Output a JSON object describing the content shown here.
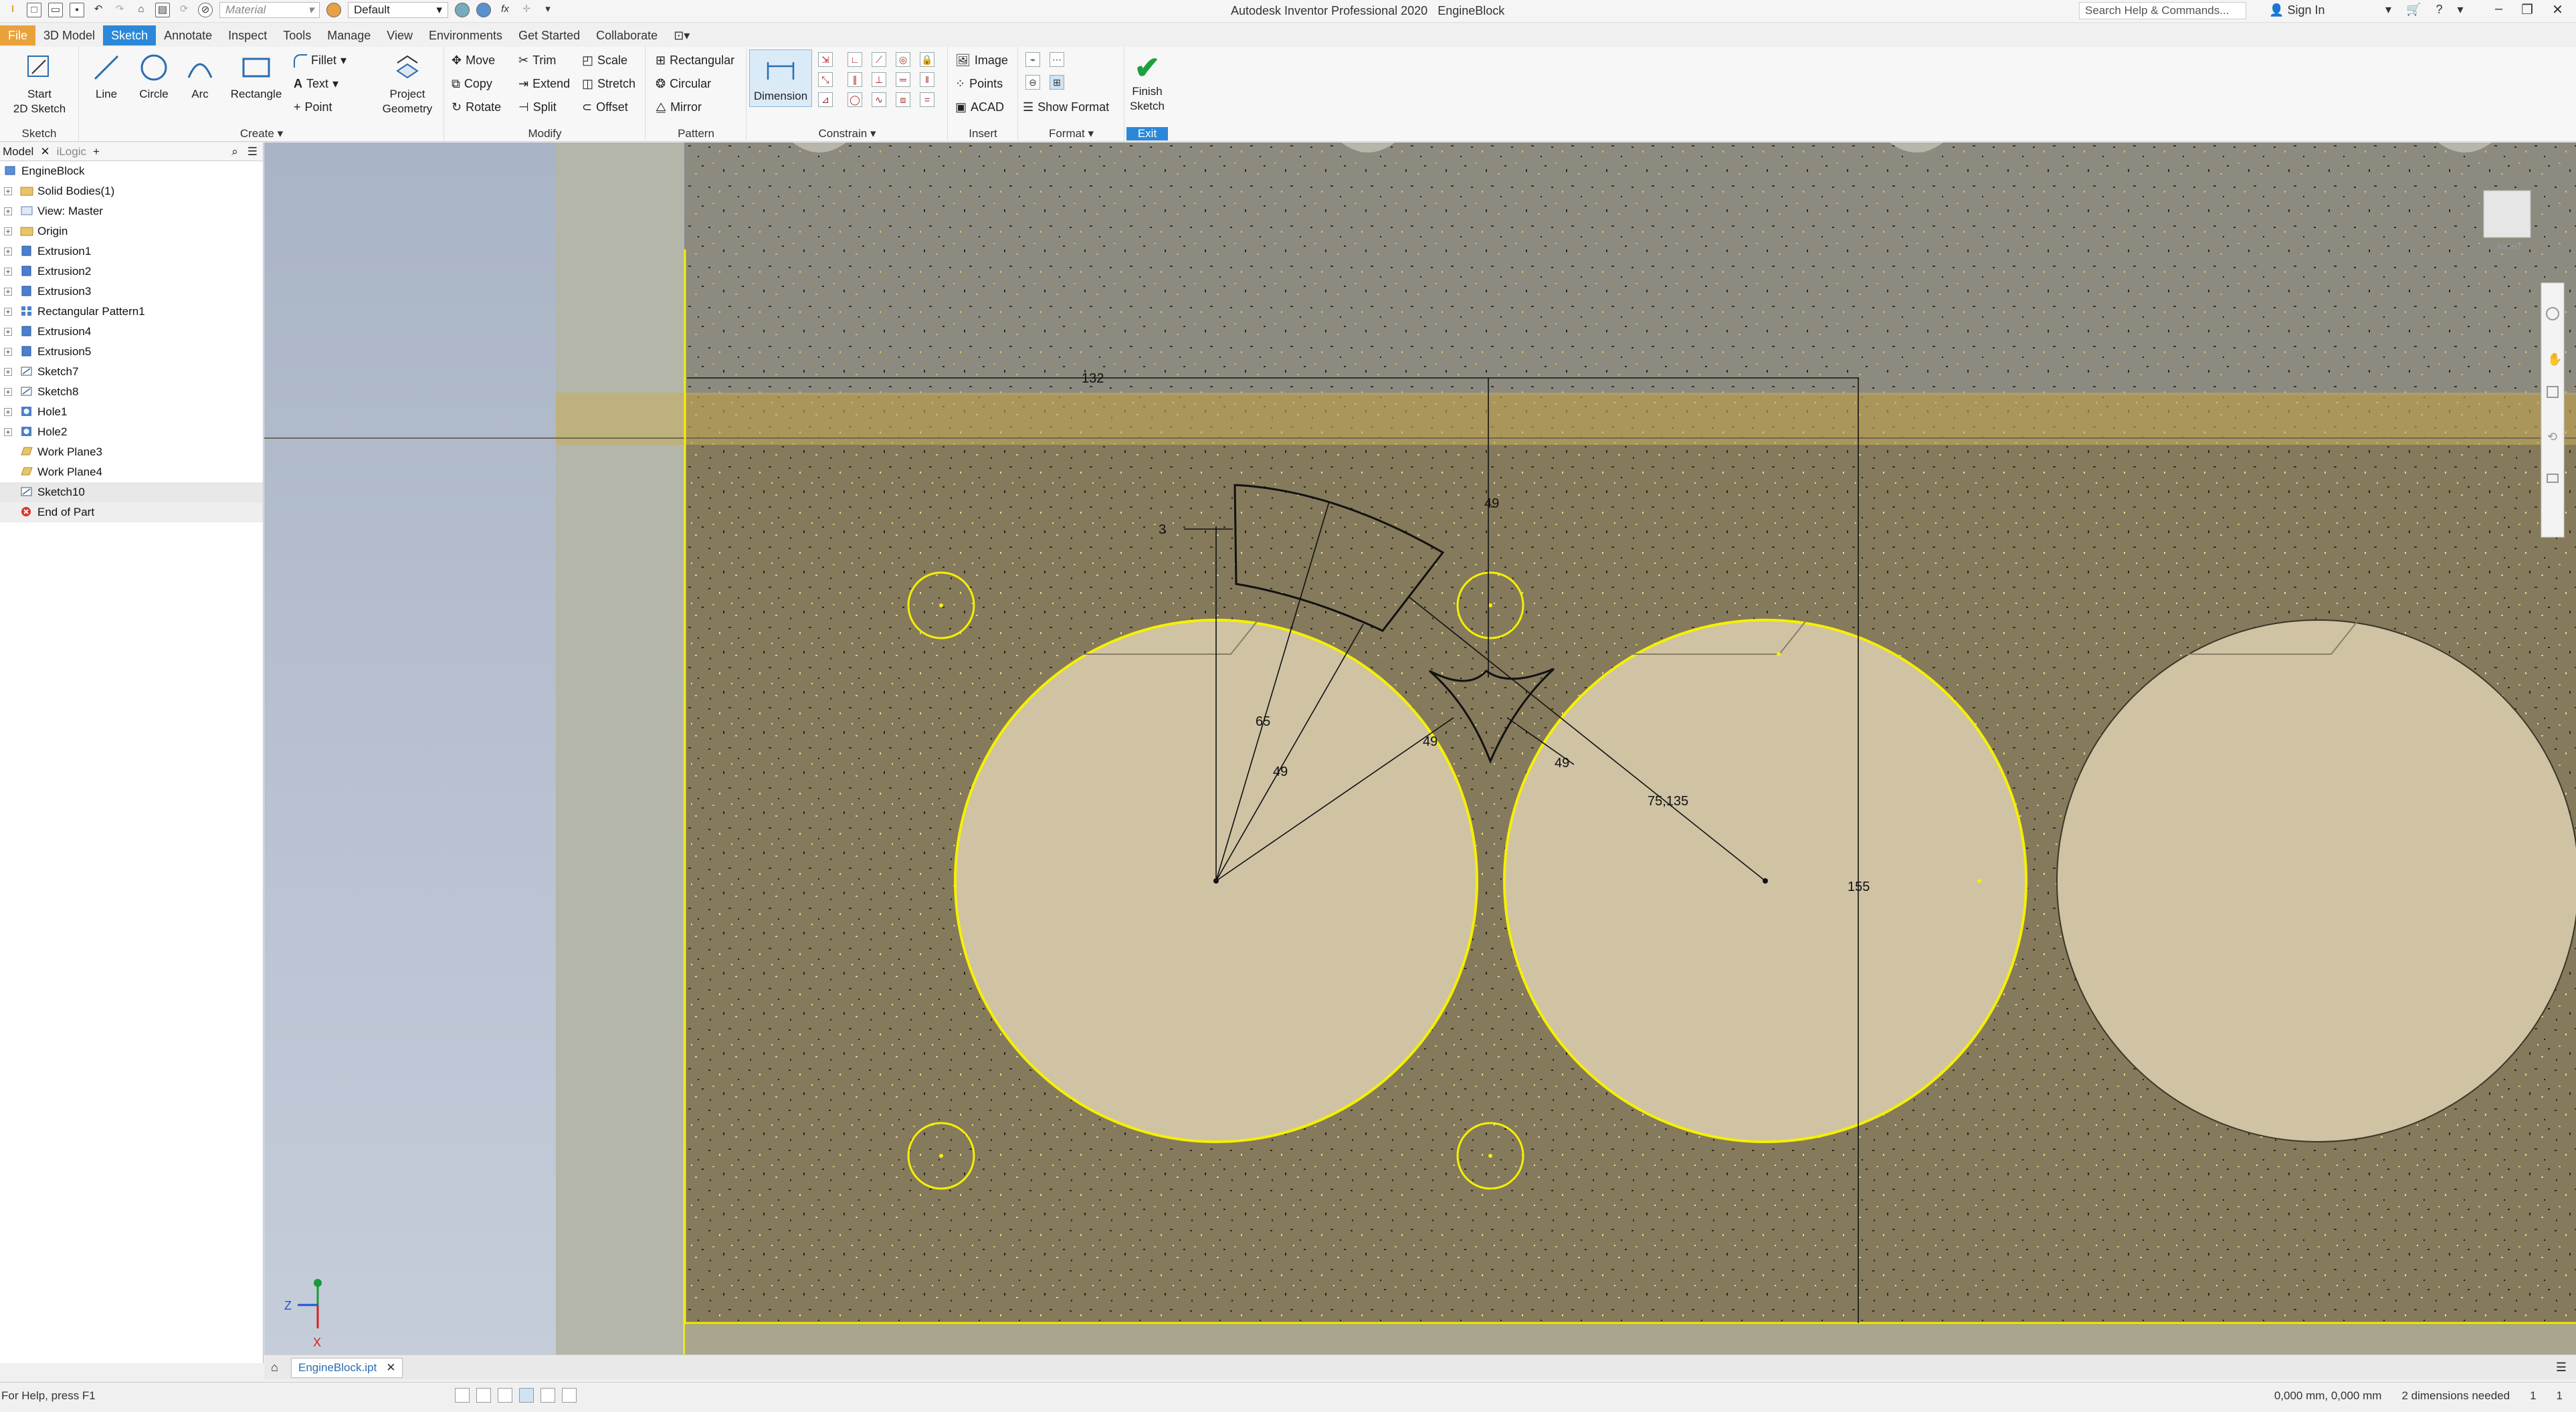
{
  "app": {
    "title": "Autodesk Inventor Professional 2020",
    "document": "EngineBlock"
  },
  "quick_access": {
    "material": "Material",
    "appearance": "Default"
  },
  "search": {
    "placeholder": "Search Help & Commands..."
  },
  "sign_in": "Sign In",
  "tabs": [
    {
      "label": "File"
    },
    {
      "label": "3D Model"
    },
    {
      "label": "Sketch"
    },
    {
      "label": "Annotate"
    },
    {
      "label": "Inspect"
    },
    {
      "label": "Tools"
    },
    {
      "label": "Manage"
    },
    {
      "label": "View"
    },
    {
      "label": "Environments"
    },
    {
      "label": "Get Started"
    },
    {
      "label": "Collaborate"
    }
  ],
  "ribbon": {
    "sketch_panel": {
      "label": "Sketch",
      "start_line1": "Start",
      "start_line2": "2D Sketch"
    },
    "create_panel": {
      "label": "Create",
      "line": "Line",
      "circle": "Circle",
      "arc": "Arc",
      "rectangle": "Rectangle",
      "fillet": "Fillet",
      "text": "Text",
      "point": "Point",
      "project_line1": "Project",
      "project_line2": "Geometry"
    },
    "modify_panel": {
      "label": "Modify",
      "move": "Move",
      "trim": "Trim",
      "scale": "Scale",
      "copy": "Copy",
      "extend": "Extend",
      "stretch": "Stretch",
      "rotate": "Rotate",
      "split": "Split",
      "offset": "Offset"
    },
    "pattern_panel": {
      "label": "Pattern",
      "rectangular": "Rectangular",
      "circular": "Circular",
      "mirror": "Mirror"
    },
    "constrain_panel": {
      "label": "Constrain",
      "dimension": "Dimension"
    },
    "insert_panel": {
      "label": "Insert",
      "image": "Image",
      "points": "Points",
      "acad": "ACAD"
    },
    "format_panel": {
      "label": "Format",
      "show_format": "Show Format"
    },
    "exit_panel": {
      "finish_line1": "Finish",
      "finish_line2": "Sketch",
      "exit": "Exit"
    }
  },
  "browser": {
    "tabs": {
      "model": "Model",
      "ilogic": "iLogic"
    },
    "root": "EngineBlock",
    "items": [
      {
        "label": "Solid Bodies(1)"
      },
      {
        "label": "View: Master"
      },
      {
        "label": "Origin"
      },
      {
        "label": "Extrusion1"
      },
      {
        "label": "Extrusion2"
      },
      {
        "label": "Extrusion3"
      },
      {
        "label": "Rectangular Pattern1"
      },
      {
        "label": "Extrusion4"
      },
      {
        "label": "Extrusion5"
      },
      {
        "label": "Sketch7"
      },
      {
        "label": "Sketch8"
      },
      {
        "label": "Hole1"
      },
      {
        "label": "Hole2"
      },
      {
        "label": "Work Plane3"
      },
      {
        "label": "Work Plane4"
      },
      {
        "label": "Sketch10"
      },
      {
        "label": "End of Part"
      }
    ]
  },
  "sketch": {
    "dimensions": {
      "d132": "132",
      "d49_vertical": "49",
      "d3": "3",
      "d65": "65",
      "d49_a": "49",
      "d49_b": "49",
      "d49_c": "49",
      "d75": "75,135",
      "d155": "155"
    },
    "triad": {
      "z": "Z",
      "x": "X"
    },
    "colors": {
      "highlight": "#f5f000",
      "bore_fill": "#cfc3a4",
      "sketch_line": "#111111"
    }
  },
  "doc_tab": {
    "label": "EngineBlock.ipt"
  },
  "status": {
    "help": "For Help, press F1",
    "coords": "0,000 mm, 0,000 mm",
    "dims_needed": "2 dimensions needed",
    "count": "1",
    "page": "1"
  }
}
